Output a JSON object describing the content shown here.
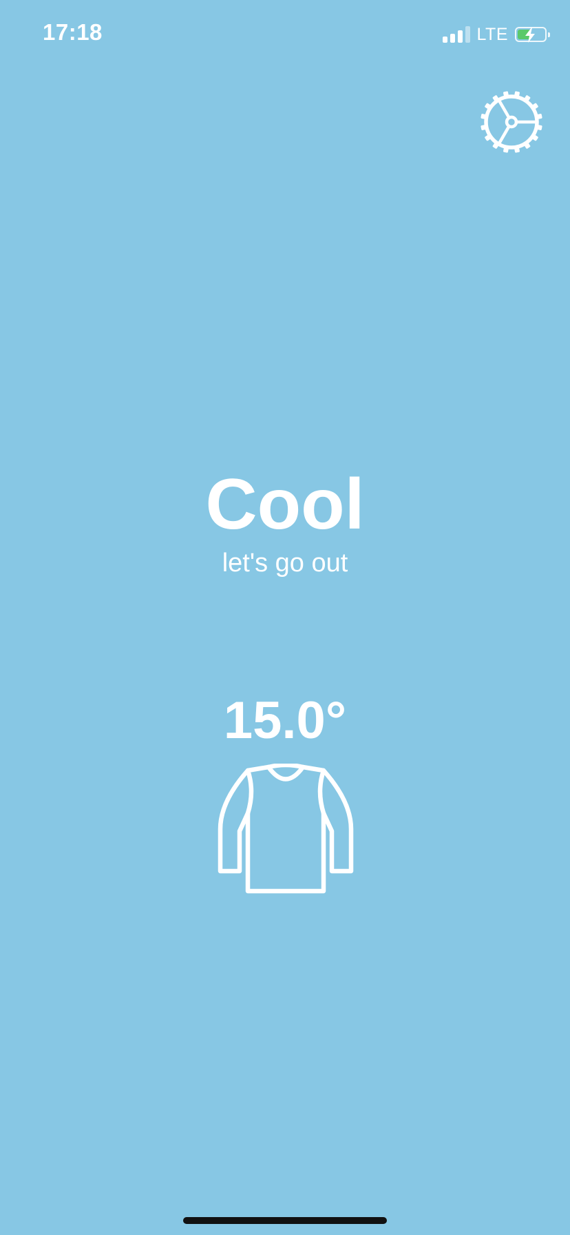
{
  "colors": {
    "background": "#87C7E4",
    "foreground": "#FFFFFF",
    "battery_fill": "#5BC96A",
    "home_indicator": "#111111"
  },
  "status_bar": {
    "time": "17:18",
    "network": "LTE",
    "signal_bars_active": 3,
    "signal_bars_total": 4,
    "battery_level": 0.5,
    "battery_charging": true
  },
  "settings": {
    "icon": "gear-icon"
  },
  "weather": {
    "condition": "Cool",
    "message": "let's go out",
    "temperature": "15.0°",
    "clothing_icon": "long-sleeve-shirt-icon"
  }
}
